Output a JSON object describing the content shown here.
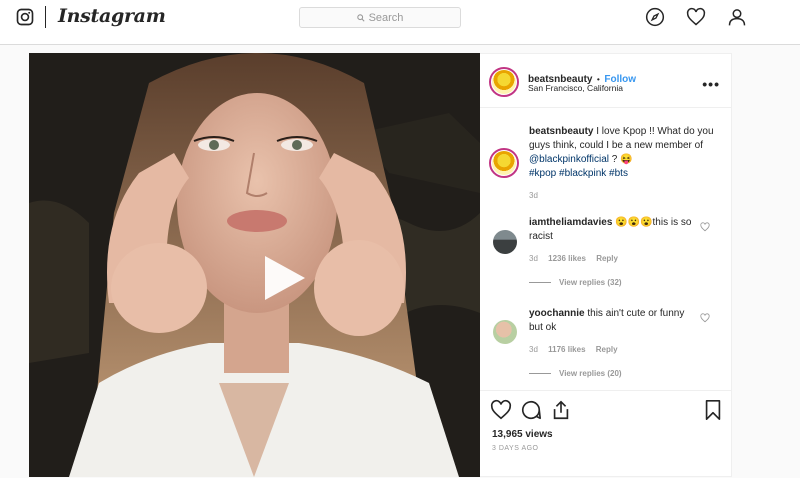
{
  "app": {
    "brand": "Instagram"
  },
  "search": {
    "placeholder": "Search"
  },
  "post": {
    "author": "beatsnbeauty",
    "follow": "Follow",
    "dot": "•",
    "location": "San Francisco, California",
    "caption_username": "beatsnbeauty",
    "caption_text": "I love Kpop !! What do you guys think, could I be a new member of",
    "caption_mention": "@blackpinkofficial",
    "caption_tail": " ? 😝",
    "hashtags": "#kpop #blackpink #bts",
    "caption_age": "3d",
    "views": "13,965 views",
    "posted": "3 DAYS AGO"
  },
  "comments": [
    {
      "username": "iamtheliamdavies",
      "text": "😮😮😮this is so racist",
      "age": "3d",
      "likes": "1236 likes",
      "reply": "Reply",
      "view_replies": "View replies (32)"
    },
    {
      "username": "yoochannie",
      "text": "this ain't cute or funny but ok",
      "age": "3d",
      "likes": "1176 likes",
      "reply": "Reply",
      "view_replies": "View replies (20)"
    }
  ],
  "colors": {
    "link": "#3897f0",
    "hashtag": "#003569",
    "ring": "#c13584"
  },
  "icons": [
    "instagram-glyph-icon",
    "search-icon",
    "compass-icon",
    "heart-icon",
    "profile-icon",
    "play-icon",
    "more-icon",
    "comment-icon",
    "share-icon",
    "bookmark-icon"
  ]
}
